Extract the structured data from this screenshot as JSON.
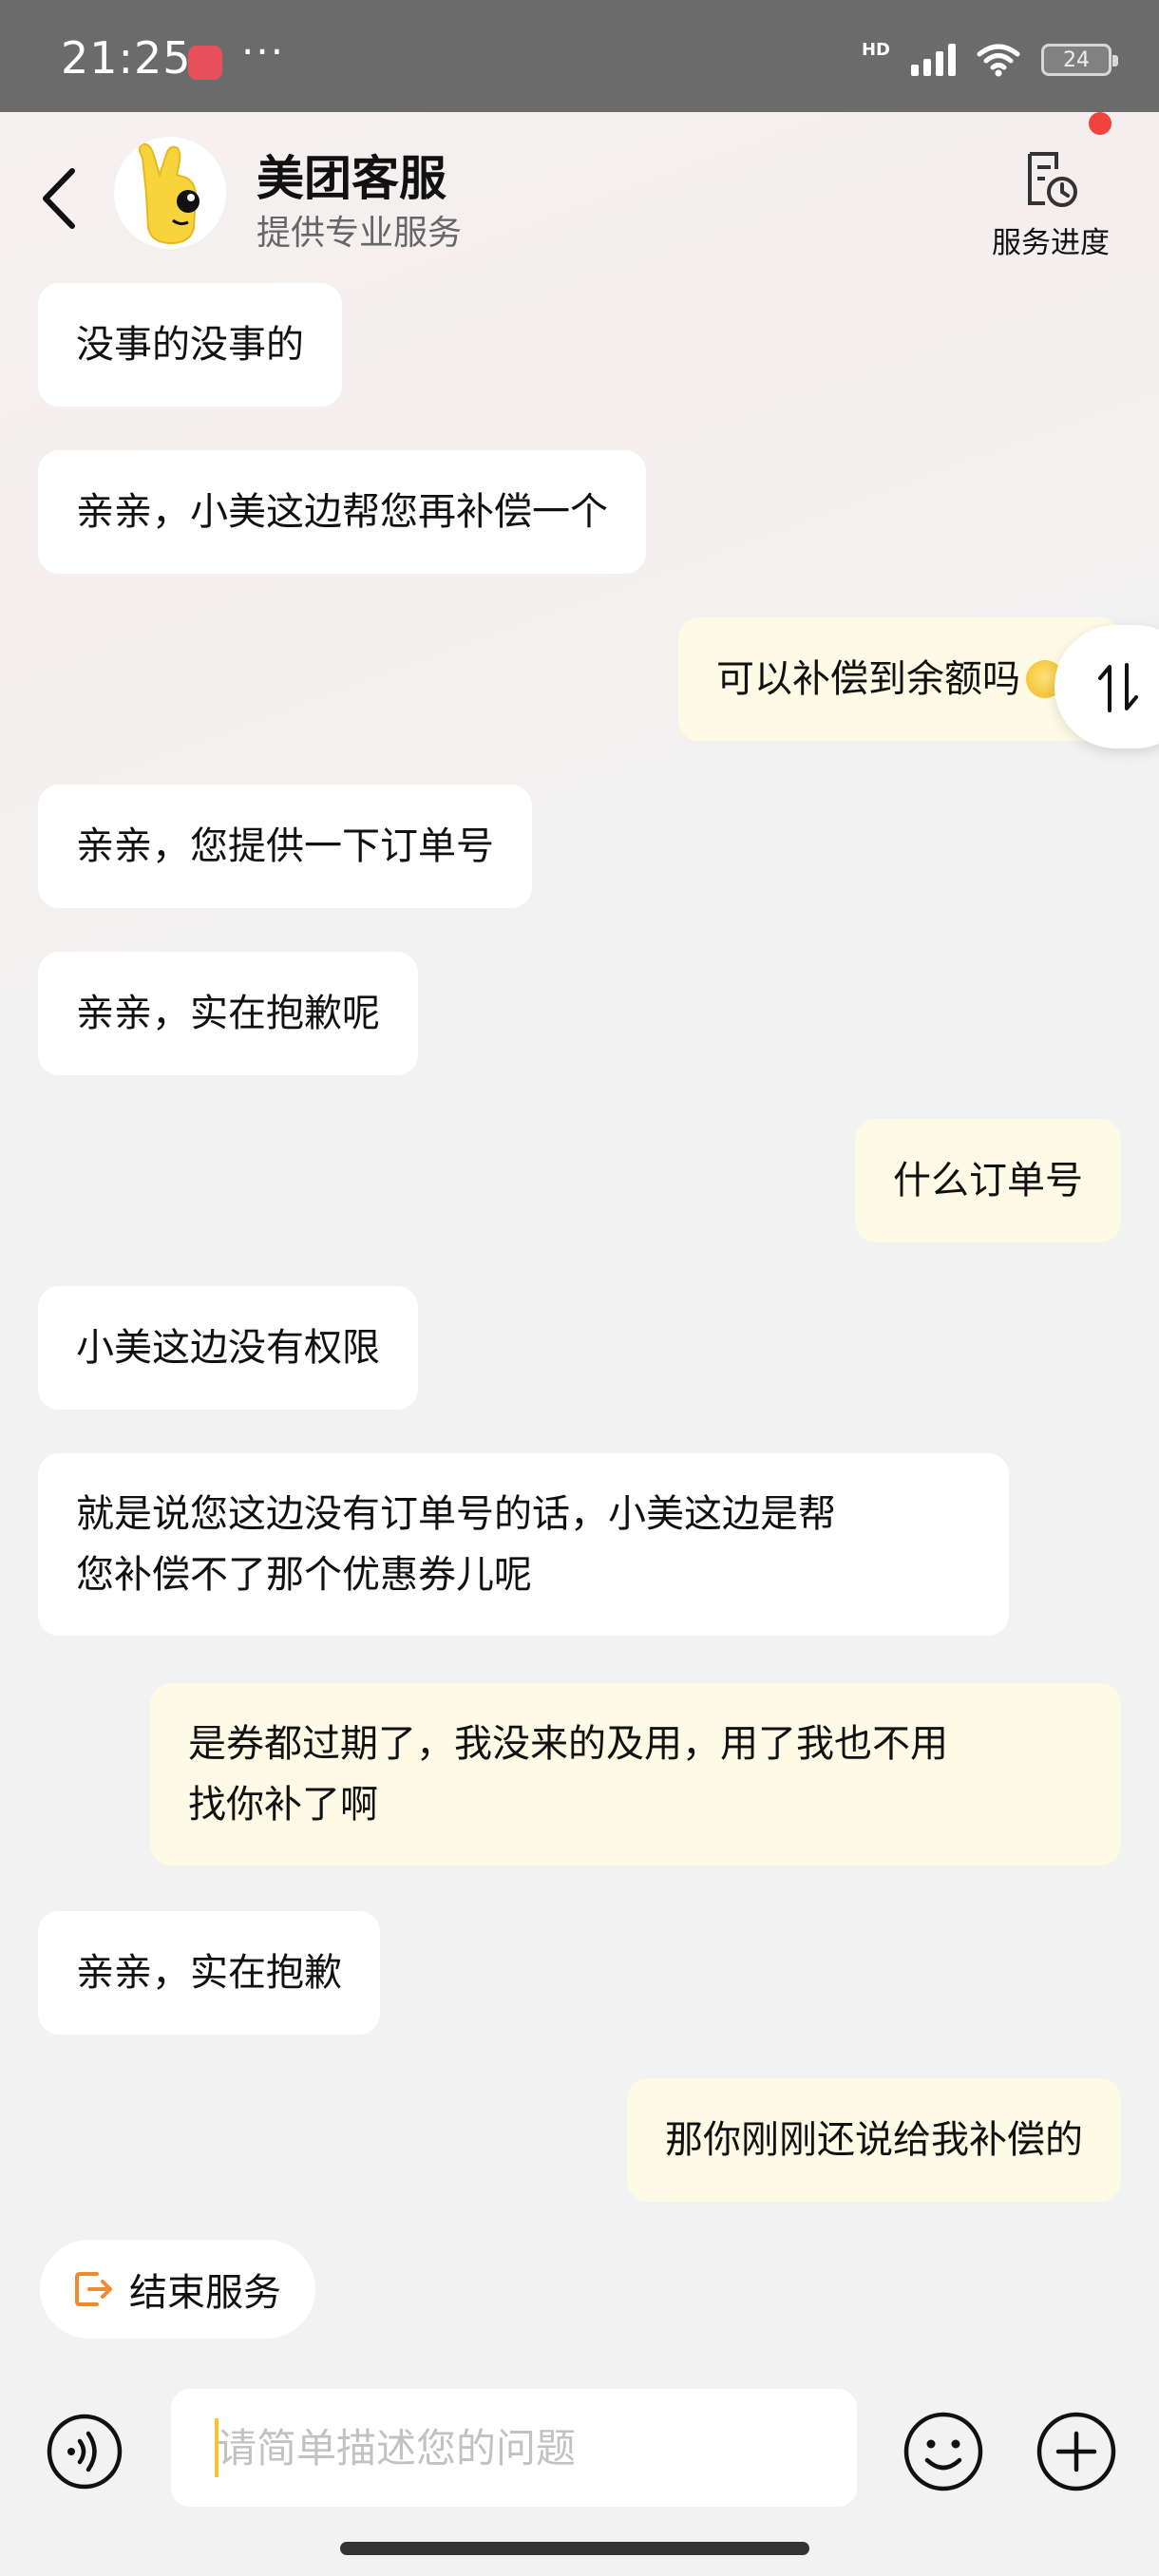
{
  "status_bar": {
    "time": "21:25",
    "dots": "···",
    "network": "HD",
    "battery": "24"
  },
  "header": {
    "title": "美团客服",
    "subtitle": "提供专业服务",
    "progress_label": "服务进度"
  },
  "messages": [
    {
      "sender": "agent",
      "text": "没事的没事的"
    },
    {
      "sender": "agent",
      "text": "亲亲，小美这边帮您再补偿一个"
    },
    {
      "sender": "user",
      "text": "可以补偿到余额吗"
    },
    {
      "sender": "agent",
      "text": "亲亲，您提供一下订单号"
    },
    {
      "sender": "agent",
      "text": "亲亲，实在抱歉呢"
    },
    {
      "sender": "user",
      "text": "什么订单号"
    },
    {
      "sender": "agent",
      "text": "小美这边没有权限"
    },
    {
      "sender": "agent",
      "lines": [
        "就是说您这边没有订单号的话，小美这边是帮",
        "您补偿不了那个优惠券儿呢"
      ]
    },
    {
      "sender": "user",
      "lines": [
        "是券都过期了，我没来的及用，用了我也不用",
        "找你补了啊"
      ]
    },
    {
      "sender": "agent",
      "text": "亲亲，实在抱歉"
    },
    {
      "sender": "user",
      "text": "那你刚刚还说给我补偿的"
    }
  ],
  "end_service_label": "结束服务",
  "input": {
    "placeholder": "请简单描述您的问题"
  },
  "colors": {
    "agent_bubble": "#ffffff",
    "user_bubble": "#fdfbe6",
    "accent_orange": "#f08a2e",
    "red_dot": "#f0443d"
  },
  "icons": [
    "back-icon",
    "service-progress-icon",
    "swap-icon",
    "end-service-icon",
    "voice-icon",
    "emoji-icon",
    "plus-icon"
  ]
}
